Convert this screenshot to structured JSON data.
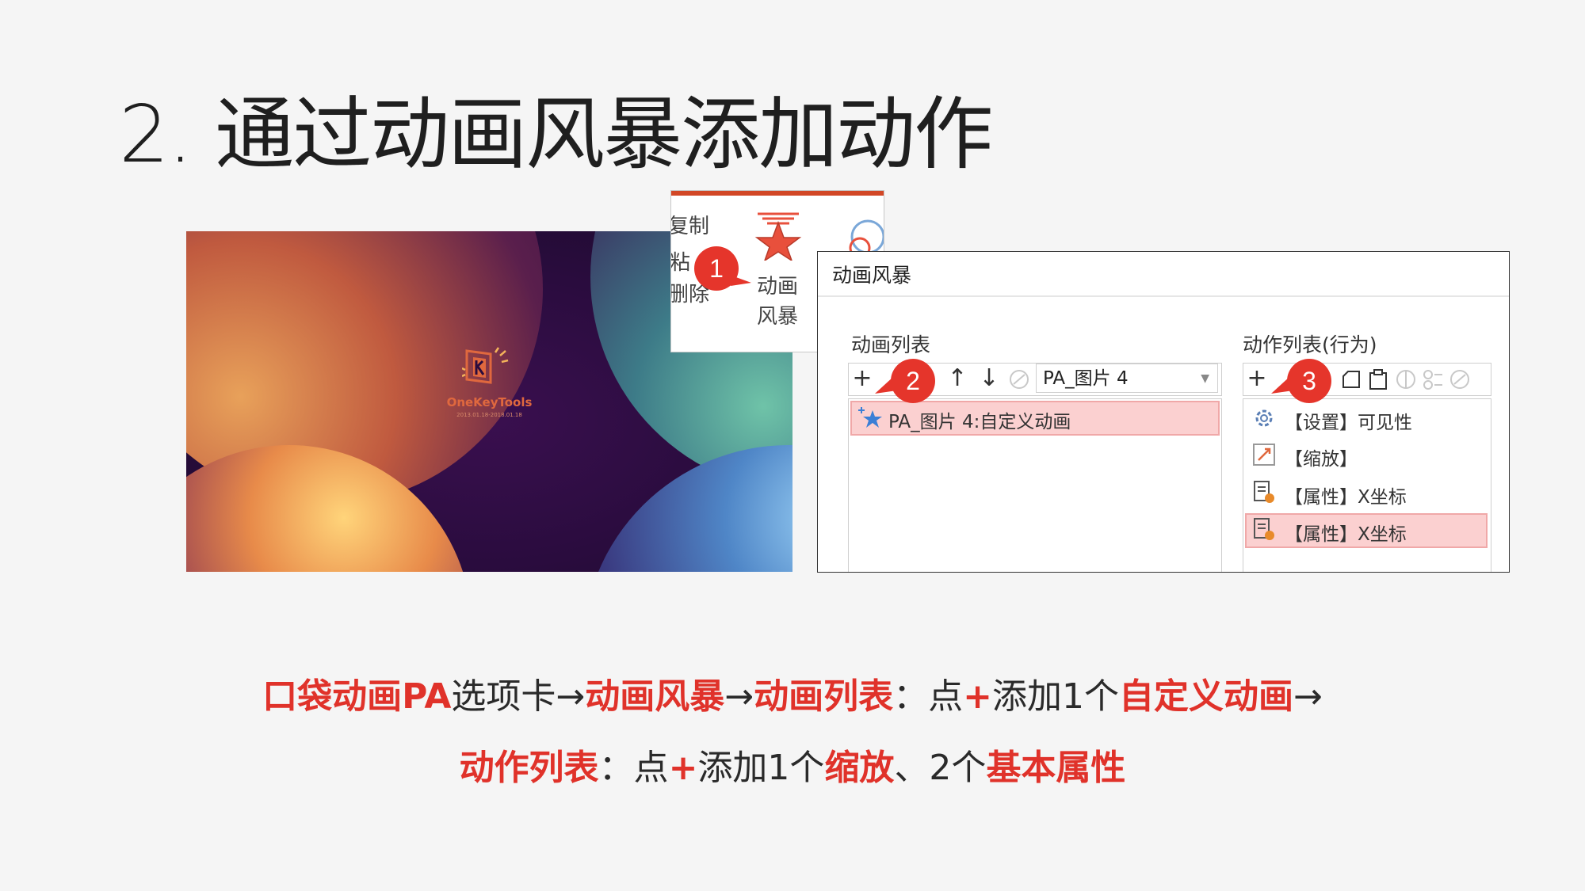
{
  "title": "2. 通过动画风暴添加动作",
  "preview": {
    "logo_name": "OneKeyTools",
    "logo_date": "2013.01.18-2018.01.18"
  },
  "ribbon": {
    "copy": "复制",
    "paste": "粘",
    "delete": "删除",
    "storm_label_1": "动画",
    "storm_label_2": "风暴"
  },
  "dialog": {
    "title": "动画风暴",
    "anim_list_label": "动画列表",
    "action_list_label": "动作列表(行为)",
    "anim_toolbar": {
      "add": "+",
      "up": "↑",
      "down": "↓"
    },
    "combo_value": "PA_图片 4",
    "anim_items": [
      {
        "label": "PA_图片 4:自定义动画",
        "selected": true
      }
    ],
    "action_items": [
      {
        "label": "【设置】可见性",
        "icon": "settings-gear-icon",
        "selected": false
      },
      {
        "label": "【缩放】",
        "icon": "scale-arrow-icon",
        "selected": false
      },
      {
        "label": "【属性】X坐标",
        "icon": "property-doc-icon",
        "selected": false
      },
      {
        "label": "【属性】X坐标",
        "icon": "property-doc-icon",
        "selected": true
      }
    ]
  },
  "callouts": [
    "1",
    "2",
    "3"
  ],
  "caption": {
    "line1": [
      {
        "text": "口袋动画PA",
        "style": "red"
      },
      {
        "text": "选项卡→",
        "style": "dark"
      },
      {
        "text": "动画风暴",
        "style": "red"
      },
      {
        "text": "→",
        "style": "dark"
      },
      {
        "text": "动画列表",
        "style": "red"
      },
      {
        "text": "：点",
        "style": "dark"
      },
      {
        "text": "+",
        "style": "red"
      },
      {
        "text": "添加1个",
        "style": "dark"
      },
      {
        "text": "自定义动画",
        "style": "red"
      },
      {
        "text": "→",
        "style": "dark"
      }
    ],
    "line2": [
      {
        "text": "动作列表",
        "style": "red"
      },
      {
        "text": "：点",
        "style": "dark"
      },
      {
        "text": "+",
        "style": "red"
      },
      {
        "text": "添加1个",
        "style": "dark"
      },
      {
        "text": "缩放",
        "style": "red"
      },
      {
        "text": "、2个",
        "style": "dark"
      },
      {
        "text": "基本属性",
        "style": "red"
      }
    ]
  },
  "colors": {
    "accent_red": "#e0322a",
    "callout_red": "#e5352b",
    "selection_pink": "#fbd0d0",
    "background": "#f5f5f5"
  }
}
